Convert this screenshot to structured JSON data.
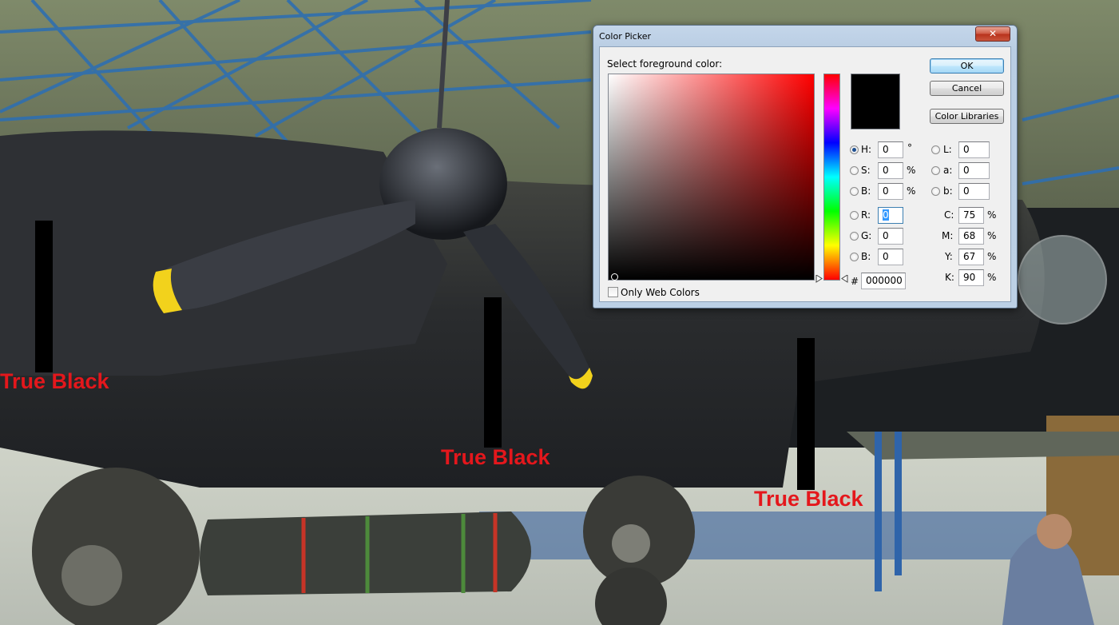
{
  "photo_labels": [
    "True Black",
    "True Black",
    "True Black"
  ],
  "colors": {
    "label_red": "#e4171c",
    "selected_color": "#000000"
  },
  "dialog": {
    "title": "Color Picker",
    "close_icon": "close-icon",
    "prompt": "Select foreground color:",
    "buttons": {
      "ok": "OK",
      "cancel": "Cancel",
      "libraries": "Color Libraries"
    },
    "hsb": {
      "h": {
        "label": "H:",
        "value": "0",
        "unit": "°"
      },
      "s": {
        "label": "S:",
        "value": "0",
        "unit": "%"
      },
      "b": {
        "label": "B:",
        "value": "0",
        "unit": "%"
      }
    },
    "lab": {
      "l": {
        "label": "L:",
        "value": "0"
      },
      "a": {
        "label": "a:",
        "value": "0"
      },
      "b": {
        "label": "b:",
        "value": "0"
      }
    },
    "rgb": {
      "r": {
        "label": "R:",
        "value": "0"
      },
      "g": {
        "label": "G:",
        "value": "0"
      },
      "b": {
        "label": "B:",
        "value": "0"
      }
    },
    "cmyk": {
      "c": {
        "label": "C:",
        "value": "75",
        "unit": "%"
      },
      "m": {
        "label": "M:",
        "value": "68",
        "unit": "%"
      },
      "y": {
        "label": "Y:",
        "value": "67",
        "unit": "%"
      },
      "k": {
        "label": "K:",
        "value": "90",
        "unit": "%"
      }
    },
    "hex": {
      "label": "#",
      "value": "000000"
    },
    "web_colors": {
      "label": "Only Web Colors",
      "checked": false
    }
  }
}
